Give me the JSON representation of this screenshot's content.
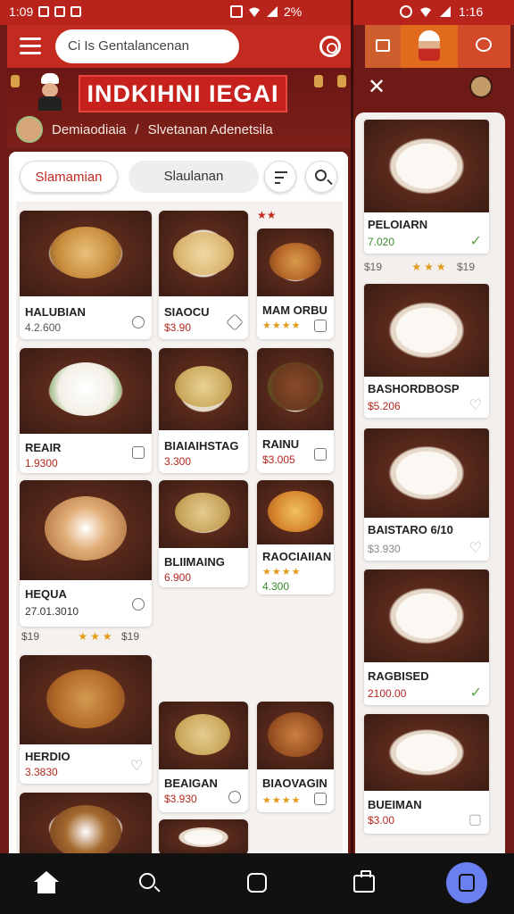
{
  "status_bar": {
    "time": "1:09",
    "battery": "2%",
    "right_time": "1:16"
  },
  "header": {
    "search_text": "Ci Is Gentalancenan"
  },
  "banner": {
    "title": "INDKIHNI IEGAI"
  },
  "breadcrumb": {
    "item1": "Demiaodiaia",
    "sep": "/",
    "item2": "Slvetanan Adenetsila"
  },
  "filters": {
    "chip1": "Slamamian",
    "chip2": "Slaulanan"
  },
  "cards": [
    {
      "name": "HALUBIAN",
      "price": "4.2.600",
      "priceColor": "#555"
    },
    {
      "name": "SIAOCU",
      "price": "$3.90"
    },
    {
      "name": "MAM ORBU",
      "stars": "★★★★"
    },
    {
      "name": "REAIR",
      "price": "1.9300"
    },
    {
      "name": "BIAIAIHSTAG",
      "price": "3.300"
    },
    {
      "name": "RAINU",
      "price": "$3.005"
    },
    {
      "name": "HEQUA",
      "price": "27.01.3010"
    },
    {
      "name": "BLIIMAING",
      "price": "6.900"
    },
    {
      "name": "RAOCIAIIAN",
      "stars": "★★★★",
      "price": "4.300"
    },
    {
      "name": "HERDIO",
      "price": "3.3830"
    },
    {
      "name": "BEAIGAN",
      "price": "$3.930"
    },
    {
      "name": "BIAOVAGIN",
      "stars": "★★★★"
    }
  ],
  "row_meta": {
    "left": "$19",
    "stars": "★★★",
    "right": "$19"
  },
  "row_meta_top": {
    "stars": "★★"
  },
  "right_panel": {
    "cards": [
      {
        "name": "PELOIARN",
        "price": "7.020"
      },
      {
        "name": "BASHORDBOSP",
        "price": "$5.206"
      },
      {
        "name": "BAISTARO 6/10",
        "price": "$3.930"
      },
      {
        "name": "RAGBISED",
        "price": "2100.00"
      },
      {
        "name": "BUEIMAN",
        "price": "$3.00"
      }
    ],
    "meta": {
      "left": "$19",
      "stars": "★★★",
      "right": "$19"
    }
  }
}
